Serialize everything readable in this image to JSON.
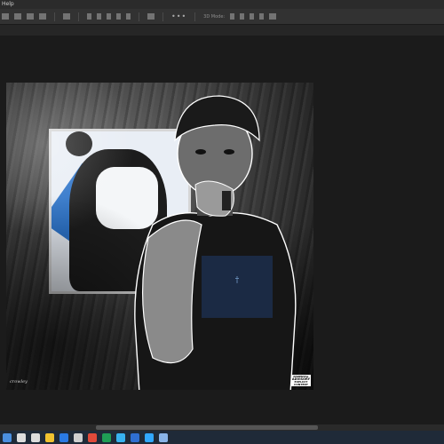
{
  "menubar": {
    "help_label": "Help"
  },
  "options_bar": {
    "mode3d_label": "3D Mode:",
    "more_label": "•••"
  },
  "artwork": {
    "advisory_label_top": "PARENTAL",
    "advisory_label_main": "ADVISORY",
    "advisory_label_bottom": "EXPLICIT CONTENT",
    "signature_text": "crowley"
  },
  "taskbar": {
    "items": [
      {
        "name": "start-icon",
        "color": "#4a8fe0"
      },
      {
        "name": "search-icon",
        "color": "#dddddd"
      },
      {
        "name": "taskview-icon",
        "color": "#dddddd"
      },
      {
        "name": "file-explorer-icon",
        "color": "#f0c230"
      },
      {
        "name": "edge-icon",
        "color": "#2a7ae4"
      },
      {
        "name": "store-icon",
        "color": "#cfcfcf"
      },
      {
        "name": "mail-icon",
        "color": "#e04a3a"
      },
      {
        "name": "excel-icon",
        "color": "#1f9d55"
      },
      {
        "name": "check-icon",
        "color": "#38b2f0"
      },
      {
        "name": "edge-dev-icon",
        "color": "#2f6fd1"
      },
      {
        "name": "photoshop-icon",
        "color": "#31a8ff"
      },
      {
        "name": "window-icon",
        "color": "#8ab4e8"
      }
    ]
  }
}
